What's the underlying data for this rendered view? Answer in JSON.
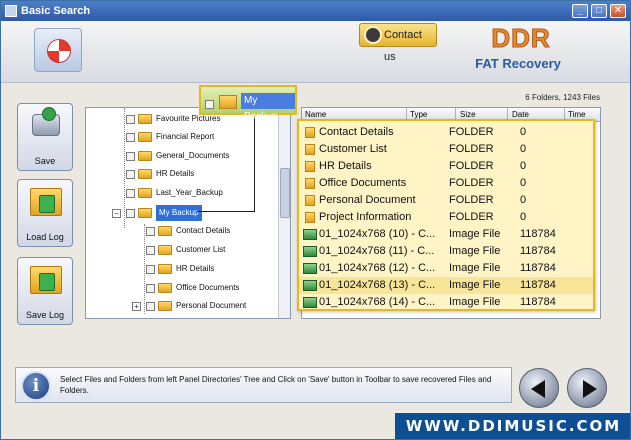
{
  "window": {
    "title": "Basic Search",
    "controls": {
      "minimize": "_",
      "maximize": "□",
      "close": "✕"
    }
  },
  "banner": {
    "contact_label": "Contact us",
    "brand": "DDR",
    "product": "FAT Recovery"
  },
  "summary": {
    "count_text": "6 Folders, 1243 Files"
  },
  "sidebar": {
    "buttons": [
      {
        "label": "Save",
        "icon": "drive-save-icon"
      },
      {
        "label": "Load Log",
        "icon": "folder-load-icon"
      },
      {
        "label": "Save Log",
        "icon": "folder-savelog-icon"
      }
    ]
  },
  "tree": {
    "items": [
      {
        "label": "Favourite Pictures"
      },
      {
        "label": "Financial Report"
      },
      {
        "label": "General_Documents"
      },
      {
        "label": "HR Details"
      },
      {
        "label": "Last_Year_Backup"
      },
      {
        "label": "My Backup",
        "selected": true,
        "expander": "−"
      },
      {
        "label": "Contact Details"
      },
      {
        "label": "Customer List"
      },
      {
        "label": "HR Details"
      },
      {
        "label": "Office Documents"
      },
      {
        "label": "Personal Document",
        "expander": "+"
      }
    ]
  },
  "callout": {
    "label": "My Backup"
  },
  "list": {
    "columns": [
      "Name",
      "Type",
      "Size",
      "Date",
      "Time"
    ],
    "rows": [
      {
        "name": "Contact Details",
        "type": "FOLDER",
        "size": "0",
        "kind": "folder"
      },
      {
        "name": "Customer List",
        "type": "FOLDER",
        "size": "0",
        "kind": "folder"
      },
      {
        "name": "HR Details",
        "type": "FOLDER",
        "size": "0",
        "kind": "folder"
      },
      {
        "name": "Office Documents",
        "type": "FOLDER",
        "size": "0",
        "kind": "folder"
      },
      {
        "name": "Personal Document",
        "type": "FOLDER",
        "size": "0",
        "kind": "folder"
      },
      {
        "name": "Project Information",
        "type": "FOLDER",
        "size": "0",
        "kind": "folder"
      },
      {
        "name": "01_1024x768 (10) - C...",
        "type": "Image File",
        "size": "118784",
        "kind": "image"
      },
      {
        "name": "01_1024x768 (11) - C...",
        "type": "Image File",
        "size": "118784",
        "kind": "image"
      },
      {
        "name": "01_1024x768 (12) - C...",
        "type": "Image File",
        "size": "118784",
        "kind": "image"
      },
      {
        "name": "01_1024x768 (13) - C...",
        "type": "Image File",
        "size": "118784",
        "kind": "image"
      },
      {
        "name": "01_1024x768 (14) - C...",
        "type": "Image File",
        "size": "118784",
        "kind": "image"
      }
    ]
  },
  "info": {
    "text": "Select Files and Folders from left Panel Directories' Tree and Click on 'Save' button in Toolbar to save recovered Files and Folders."
  },
  "footer": {
    "website": "WWW.DDIMUSIC.COM"
  },
  "colors": {
    "title_bar": "#2e5aa8",
    "brand_orange": "#e8892a",
    "product_blue": "#2c5aa4",
    "highlight_border": "#e6b81f",
    "footer_blue": "#0e4f94"
  }
}
